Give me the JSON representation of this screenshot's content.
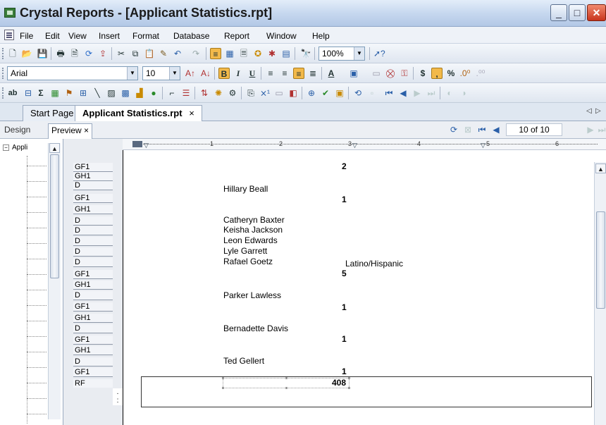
{
  "window": {
    "title": "Crystal Reports - [Applicant Statistics.rpt]",
    "minimize_icon": "minimize-icon",
    "maximize_icon": "maximize-icon",
    "close_icon": "close-icon"
  },
  "menu": {
    "items": [
      "File",
      "Edit",
      "View",
      "Insert",
      "Format",
      "Database",
      "Report",
      "Window",
      "Help"
    ]
  },
  "toolbar1": {
    "zoom_value": "100%"
  },
  "toolbar2": {
    "font_name": "Arial",
    "font_size": "10",
    "bold": "B",
    "italic": "I",
    "underline": "U",
    "currency": "$",
    "comma": ",",
    "percent": "%"
  },
  "toolbar3": {
    "text_object": "ab"
  },
  "doc_tabs": {
    "start_page": "Start Page",
    "active": "Applicant Statistics.rpt",
    "close": "×"
  },
  "view_tabs": {
    "design": "Design",
    "preview": "Preview",
    "close": "×",
    "page_indicator": "10 of 10"
  },
  "tree": {
    "root_label": "Appli"
  },
  "sections": [
    "GF1",
    "GH1",
    "D",
    "GF1",
    "GH1",
    "D",
    "D",
    "D",
    "D",
    "D",
    "GF1",
    "GH1",
    "D",
    "GF1",
    "GH1",
    "D",
    "GF1",
    "GH1",
    "D",
    "GF1",
    "RF"
  ],
  "ruler": {
    "marks": [
      "1",
      "2",
      "3",
      "4",
      "5",
      "6"
    ]
  },
  "report": {
    "count_top": "2",
    "names": [
      "Hillary Beall",
      "Catheryn Baxter",
      "Keisha Jackson",
      "Leon Edwards",
      "Lyle Garrett",
      "Rafael Goetz",
      "Parker Lawless",
      "Bernadette Davis",
      "Ted Gellert"
    ],
    "ethnicity": "Latino/Hispanic",
    "counts": [
      "1",
      "5",
      "1",
      "1",
      "1"
    ],
    "grand_total": "408"
  }
}
